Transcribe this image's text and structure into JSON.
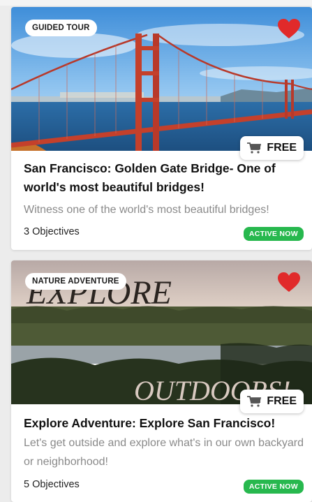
{
  "cards": [
    {
      "tag": "GUIDED TOUR",
      "price": "FREE",
      "title": "San Francisco: Golden Gate Bridge- One of world's most beautiful bridges!",
      "description": "Witness one of the world's most beautiful bridges!",
      "objectives": "3 Objectives",
      "status": "ACTIVE NOW",
      "favorited": true
    },
    {
      "tag": "NATURE ADVENTURE",
      "price": "FREE",
      "image_text_top": "EXPLORE",
      "image_text_bottom": "OUTDOORS!",
      "title": "Explore Adventure: Explore San Francisco!",
      "description": "Let's get outside and explore what's in our own backyard or neighborhood!",
      "objectives": "5 Objectives",
      "status": "ACTIVE NOW",
      "favorited": true
    }
  ],
  "colors": {
    "heart": "#e12a2a",
    "active_badge": "#27b84e",
    "bridge": "#c4402b"
  },
  "icons": [
    "heart-icon",
    "cart-icon"
  ]
}
